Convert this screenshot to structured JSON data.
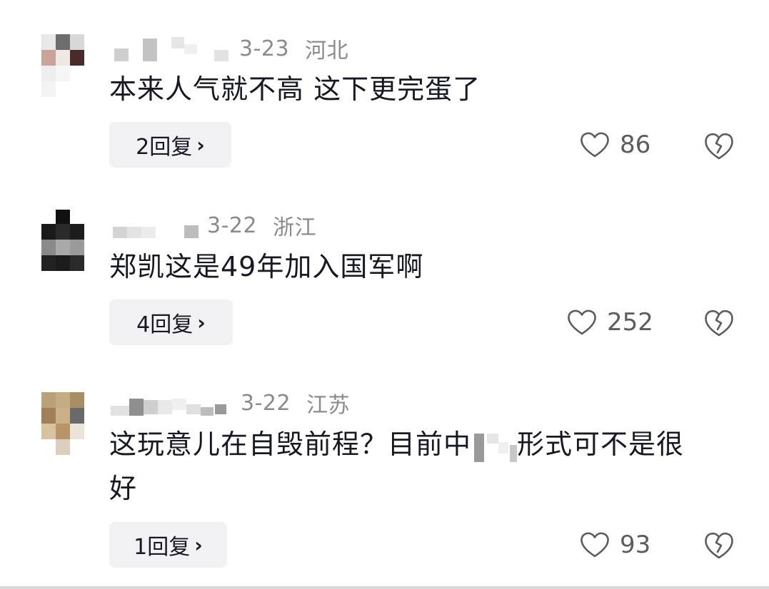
{
  "comments": [
    {
      "date": "3-23",
      "location": "河北",
      "text": "本来人气就不高 这下更完蛋了",
      "replies_label": "2回复",
      "likes": "86"
    },
    {
      "date": "3-22",
      "location": "浙江",
      "text": "郑凯这是49年加入国军啊",
      "replies_label": "4回复",
      "likes": "252"
    },
    {
      "date": "3-22",
      "location": "江苏",
      "text_before_redaction": "这玩意儿在自毁前程？目前中",
      "text_after_redaction": "形式可不是很",
      "text_line2": "好",
      "replies_label": "1回复",
      "likes": "93"
    }
  ],
  "icons": {
    "like": "heart-outline-icon",
    "dislike": "broken-heart-icon",
    "reply_chevron": "›"
  },
  "colors": {
    "text_primary": "#161823",
    "text_secondary": "#8a8b91",
    "reply_bg": "#f2f2f4",
    "icon": "#5b5c63"
  }
}
